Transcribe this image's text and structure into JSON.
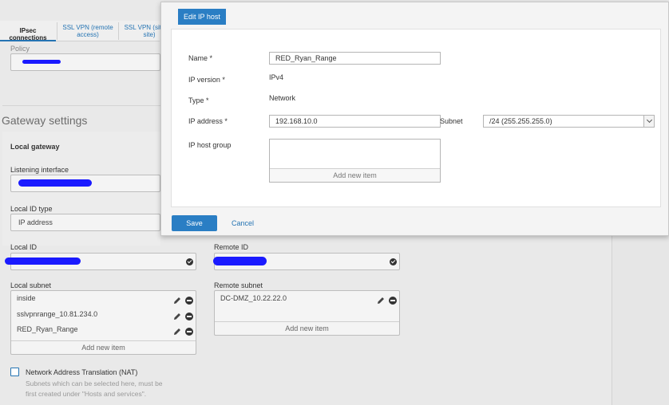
{
  "tabs": [
    {
      "label": "IPsec connections"
    },
    {
      "label": "SSL VPN (remote access)"
    },
    {
      "label": "SSL VPN (site-to-site)"
    }
  ],
  "policy": {
    "label": "Policy"
  },
  "gateway": {
    "section_title": "Gateway settings",
    "local_gateway_title": "Local gateway",
    "listening_interface_label": "Listening interface",
    "local_id_type_label": "Local ID type",
    "local_id_type_value": "IP address",
    "local_id_label": "Local ID",
    "remote_id_label": "Remote ID"
  },
  "local_subnet": {
    "label": "Local subnet",
    "items": [
      "inside",
      "sslvpnrange_10.81.234.0",
      "RED_Ryan_Range"
    ],
    "add_new": "Add new item"
  },
  "remote_subnet": {
    "label": "Remote subnet",
    "items": [
      "DC-DMZ_10.22.22.0"
    ],
    "add_new": "Add new item"
  },
  "nat": {
    "label": "Network Address Translation (NAT)",
    "hint_line1": "Subnets which can be selected here, must be",
    "hint_line2": "first created under \"Hosts and services\"."
  },
  "modal": {
    "title": "Edit IP host",
    "name_label": "Name *",
    "name_value": "RED_Ryan_Range",
    "ip_version_label": "IP version *",
    "ip_version_value": "IPv4",
    "type_label": "Type *",
    "type_value": "Network",
    "ip_address_label": "IP address *",
    "ip_address_value": "192.168.10.0",
    "subnet_label": "Subnet",
    "subnet_value": "/24 (255.255.255.0)",
    "ip_host_group_label": "IP host group",
    "ip_host_group_add": "Add new item",
    "save_label": "Save",
    "cancel_label": "Cancel"
  },
  "colors": {
    "accent": "#2a7ec4",
    "link": "#2574b3",
    "redaction": "#1a1aff"
  }
}
